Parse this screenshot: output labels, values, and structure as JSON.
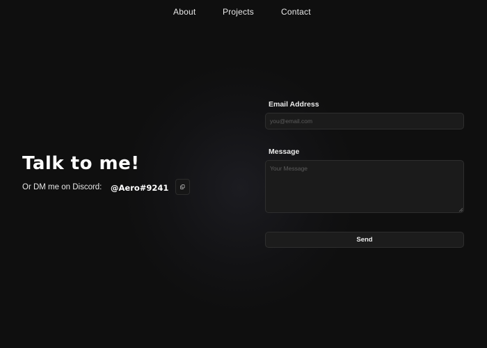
{
  "nav": {
    "links": [
      {
        "label": "About"
      },
      {
        "label": "Projects"
      },
      {
        "label": "Contact"
      }
    ]
  },
  "hero": {
    "title": "Talk to me!",
    "discord_label": "Or DM me on Discord:",
    "discord_handle": "@Aero#9241",
    "copy_icon": "copy-icon"
  },
  "form": {
    "email_label": "Email Address",
    "email_placeholder": "you@email.com",
    "email_value": "",
    "message_label": "Message",
    "message_placeholder": "Your Message",
    "message_value": "",
    "send_label": "Send"
  },
  "colors": {
    "background": "#0f0f0f",
    "field_background": "#1b1b1b",
    "field_border": "#2e2e2e",
    "text": "#ffffff"
  }
}
